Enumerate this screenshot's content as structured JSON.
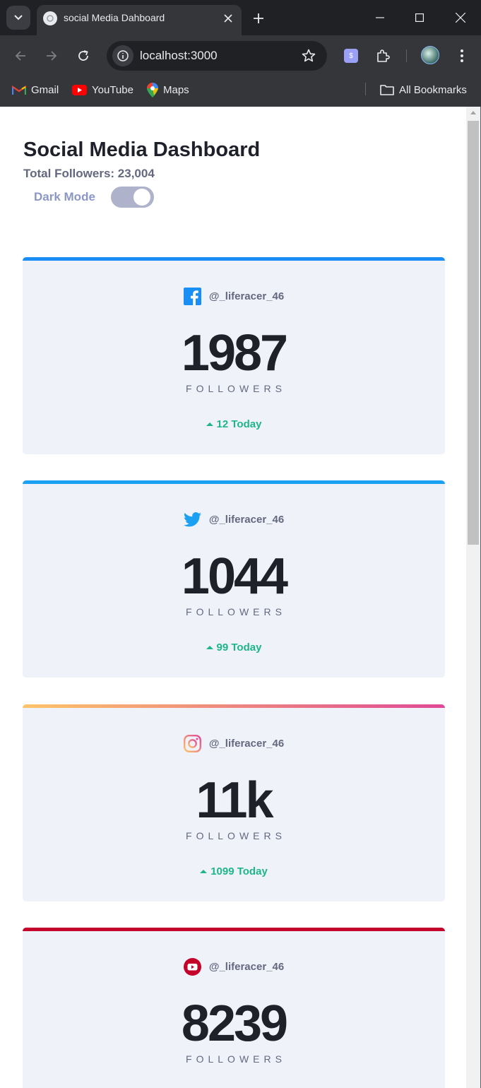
{
  "browser": {
    "tab_title": "social Media Dahboard",
    "url": "localhost:3000",
    "bookmarks": [
      {
        "label": "Gmail",
        "icon": "gmail-icon"
      },
      {
        "label": "YouTube",
        "icon": "youtube-icon"
      },
      {
        "label": "Maps",
        "icon": "maps-icon"
      }
    ],
    "all_bookmarks": "All Bookmarks"
  },
  "header": {
    "title": "Social Media Dashboard",
    "total_followers": "Total Followers: 23,004",
    "dark_mode_label": "Dark Mode",
    "dark_mode_on": false
  },
  "cards": [
    {
      "platform_icon": "facebook-icon",
      "accent": "#198ff5",
      "handle": "@_liferacer_46",
      "count": "1987",
      "label": "FOLLOWERS",
      "today": "12 Today"
    },
    {
      "platform_icon": "twitter-icon",
      "accent": "#1ca0f2",
      "handle": "@_liferacer_46",
      "count": "1044",
      "label": "FOLLOWERS",
      "today": "99 Today"
    },
    {
      "platform_icon": "instagram-icon",
      "accent": "#fdc468",
      "handle": "@_liferacer_46",
      "count": "11k",
      "label": "FOLLOWERS",
      "today": "1099 Today"
    },
    {
      "platform_icon": "youtube-icon",
      "accent": "#c4032b",
      "handle": "@_liferacer_46",
      "count": "8239",
      "label": "FOLLOWERS",
      "today": ""
    }
  ],
  "colors": {
    "facebook": "#198ff5",
    "twitter": "#1ca0f2",
    "instagram_start": "#fdc468",
    "instagram_end": "#df4996",
    "youtube": "#c4032b",
    "positive": "#1eb589"
  }
}
